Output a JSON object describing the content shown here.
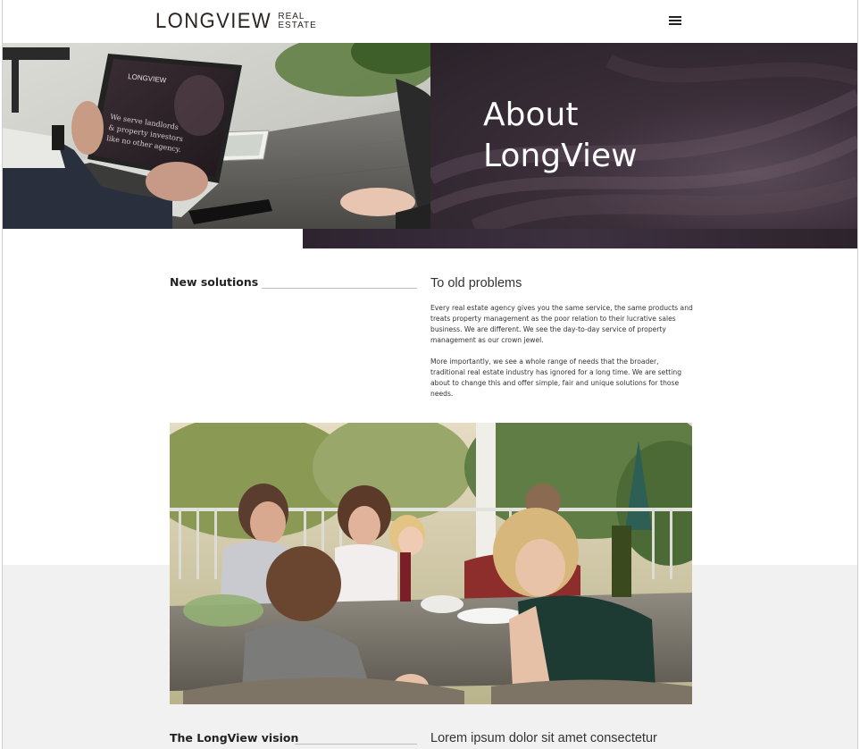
{
  "header": {
    "logo_main": "LONGVIEW",
    "logo_sub_top": "REAL",
    "logo_sub_bottom": "ESTATE"
  },
  "hero": {
    "title_line1": "About",
    "title_line2": "LongView",
    "laptop_screen_brand": "LONGVIEW",
    "laptop_screen_text": "We serve landlords & property investors like no other agency."
  },
  "section_solutions": {
    "label": "New solutions",
    "heading": "To old problems",
    "paragraph1": "Every real estate agency gives you the same service, the same products and treats property management as the poor relation to their lucrative sales business. We are different. We see the day-to-day service of property management as our crown jewel.",
    "paragraph2": "More importantly, we see a whole range of needs that the broader, traditional real estate industry has ignored for a long time. We are setting about to change this and offer simple, fair and unique solutions for those needs."
  },
  "section_vision": {
    "label": "The LongView vision",
    "heading": "Lorem ipsum dolor sit amet consectetur"
  },
  "colors": {
    "hero_panel": "#3b2f3a",
    "grey_band": "#f1f1f1",
    "text_dark": "#222222"
  },
  "icons": {
    "menu": "hamburger-menu-icon"
  }
}
